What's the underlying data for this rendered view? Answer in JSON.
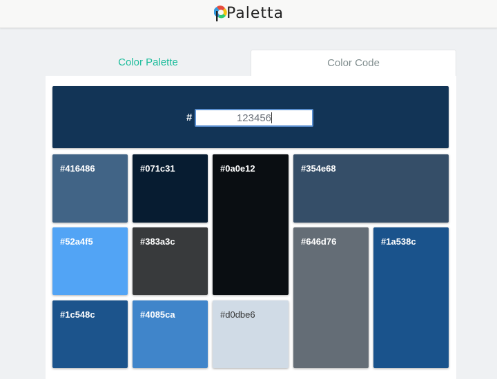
{
  "header": {
    "logo_text": "Paletta",
    "logo_icon": "palette-ring-icon"
  },
  "tabs": [
    {
      "label": "Color Palette",
      "active": false
    },
    {
      "label": "Color Code",
      "active": true
    }
  ],
  "color_code": {
    "prefix": "#",
    "value": "123456",
    "color": "#123456"
  },
  "swatches": [
    {
      "label": "#416486",
      "color": "#416486"
    },
    {
      "label": "#071c31",
      "color": "#071c31"
    },
    {
      "label": "#0a0e12",
      "color": "#0a0e12"
    },
    {
      "label": "#354e68",
      "color": "#354e68"
    },
    {
      "label": "#52a4f5",
      "color": "#52a4f5"
    },
    {
      "label": "#383a3c",
      "color": "#383a3c"
    },
    {
      "label": "#646d76",
      "color": "#646d76"
    },
    {
      "label": "#1a538c",
      "color": "#1a538c"
    },
    {
      "label": "#1c548c",
      "color": "#1c548c"
    },
    {
      "label": "#4085ca",
      "color": "#4085ca"
    },
    {
      "label": "#d0dbe6",
      "color": "#d0dbe6"
    }
  ]
}
